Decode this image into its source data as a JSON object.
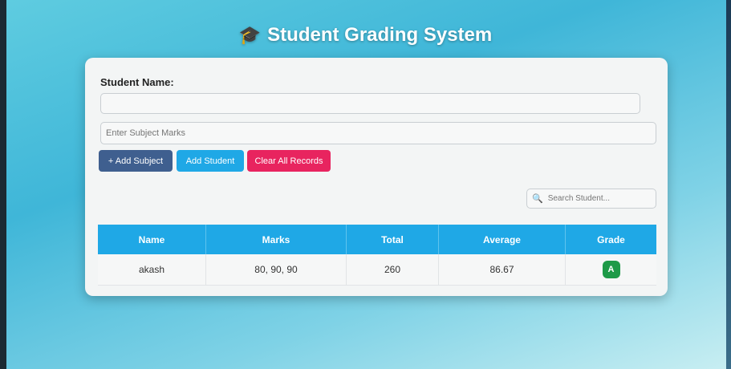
{
  "header": {
    "icon": "graduation-cap-icon",
    "title": "Student Grading System"
  },
  "form": {
    "student_name_label": "Student Name:",
    "student_name_value": "",
    "marks_placeholder": "Enter Subject Marks",
    "add_subject_label": "+ Add Subject",
    "add_student_label": "Add Student",
    "clear_label": "Clear All Records"
  },
  "search": {
    "icon": "search-icon",
    "placeholder": "Search Student..."
  },
  "table": {
    "columns": [
      "Name",
      "Marks",
      "Total",
      "Average",
      "Grade"
    ],
    "rows": [
      {
        "name": "akash",
        "marks": "80, 90, 90",
        "total": "260",
        "average": "86.67",
        "grade": "A"
      }
    ]
  },
  "colors": {
    "primary": "#1fa8e6",
    "add_subject": "#3f5f8f",
    "clear": "#e8245f",
    "grade_a": "#1e9a48"
  }
}
